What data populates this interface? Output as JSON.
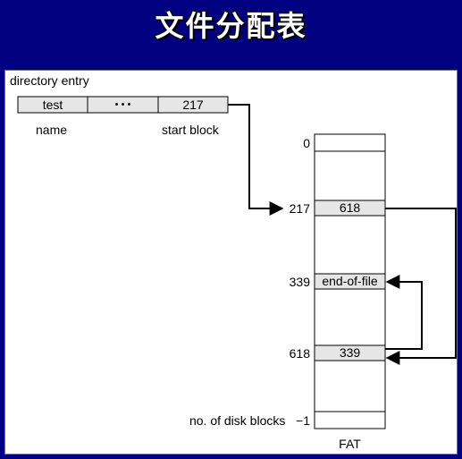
{
  "title": "文件分配表",
  "directory": {
    "caption": "directory entry",
    "fields": [
      "test",
      "• • •",
      "217"
    ],
    "labels": [
      "name",
      "start block"
    ]
  },
  "fat": {
    "caption": "FAT",
    "row_labels": [
      "0",
      "217",
      "339",
      "618",
      "no. of disk blocks   −1"
    ],
    "entries": [
      "618",
      "end-of-file",
      "339"
    ]
  },
  "colors": {
    "title_bar": "#000080",
    "cell_fill": "#e6e6e6"
  }
}
